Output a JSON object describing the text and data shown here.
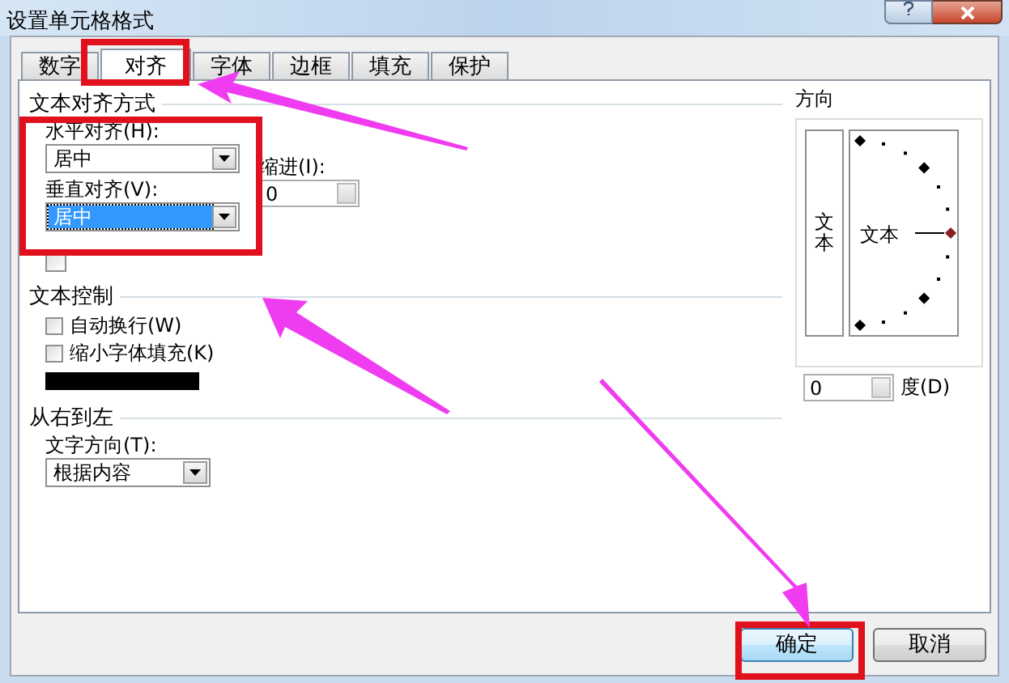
{
  "window": {
    "title": "设置单元格格式"
  },
  "tabs": [
    {
      "label": "数字",
      "selected": false
    },
    {
      "label": "对齐",
      "selected": true
    },
    {
      "label": "字体",
      "selected": false
    },
    {
      "label": "边框",
      "selected": false
    },
    {
      "label": "填充",
      "selected": false
    },
    {
      "label": "保护",
      "selected": false
    }
  ],
  "alignment": {
    "title": "文本对齐方式",
    "horizontal": {
      "label": "水平对齐(H):",
      "value": "居中",
      "selected": false
    },
    "indent": {
      "label": "缩进(I):",
      "value": "0"
    },
    "vertical": {
      "label": "垂直对齐(V):",
      "value": "居中",
      "selected": true
    },
    "distributed": {
      "checked": false
    }
  },
  "text_control": {
    "title": "文本控制",
    "options": [
      {
        "kind": "checkbox",
        "label": "自动换行(W)",
        "checked": false
      },
      {
        "kind": "checkbox",
        "label": "缩小字体填充(K)",
        "checked": false
      },
      {
        "kind": "redacted"
      }
    ]
  },
  "right_to_left": {
    "title": "从右到左",
    "direction": {
      "label": "文字方向(T):",
      "value": "根据内容"
    }
  },
  "orientation": {
    "title": "方向",
    "vertical_text": "文本",
    "dial_text": "文本",
    "degrees": {
      "value": "0",
      "label": "度(D)"
    }
  },
  "buttons": [
    {
      "label": "确定"
    },
    {
      "label": "取消"
    }
  ]
}
